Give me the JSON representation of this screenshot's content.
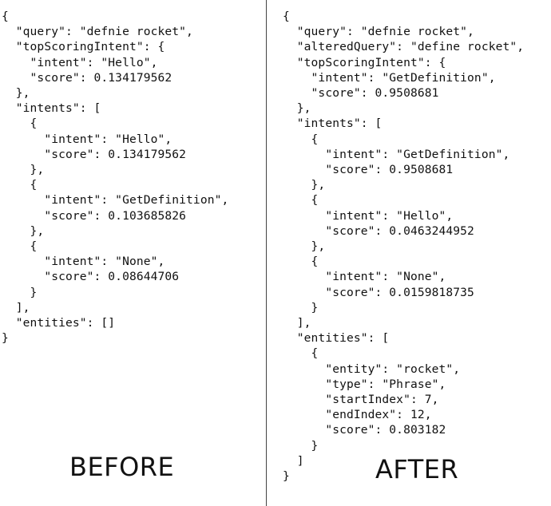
{
  "before": {
    "caption": "BEFORE",
    "code_lines": [
      "{",
      "  \"query\": \"defnie rocket\",",
      "  \"topScoringIntent\": {",
      "    \"intent\": \"Hello\",",
      "    \"score\": 0.134179562",
      "  },",
      "  \"intents\": [",
      "    {",
      "      \"intent\": \"Hello\",",
      "      \"score\": 0.134179562",
      "    },",
      "    {",
      "      \"intent\": \"GetDefinition\",",
      "      \"score\": 0.103685826",
      "    },",
      "    {",
      "      \"intent\": \"None\",",
      "      \"score\": 0.08644706",
      "    }",
      "  ],",
      "  \"entities\": []",
      "}"
    ]
  },
  "after": {
    "caption": "AFTER",
    "code_lines": [
      "{",
      "  \"query\": \"defnie rocket\",",
      "  \"alteredQuery\": \"define rocket\",",
      "  \"topScoringIntent\": {",
      "    \"intent\": \"GetDefinition\",",
      "    \"score\": 0.9508681",
      "  },",
      "  \"intents\": [",
      "    {",
      "      \"intent\": \"GetDefinition\",",
      "      \"score\": 0.9508681",
      "    },",
      "    {",
      "      \"intent\": \"Hello\",",
      "      \"score\": 0.0463244952",
      "    },",
      "    {",
      "      \"intent\": \"None\",",
      "      \"score\": 0.0159818735",
      "    }",
      "  ],",
      "  \"entities\": [",
      "    {",
      "      \"entity\": \"rocket\",",
      "      \"type\": \"Phrase\",",
      "      \"startIndex\": 7,",
      "      \"endIndex\": 12,",
      "      \"score\": 0.803182",
      "    }",
      "  ]",
      "}"
    ]
  }
}
